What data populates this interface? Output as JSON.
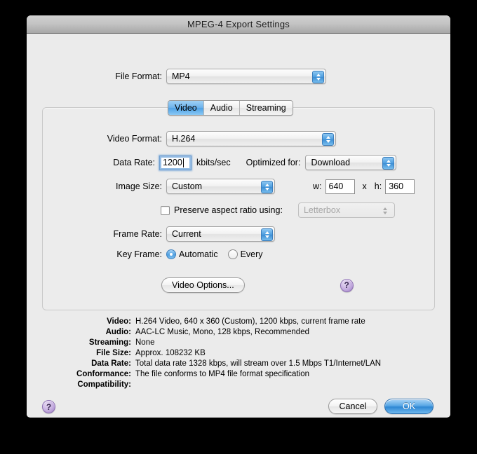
{
  "window": {
    "title": "MPEG-4 Export Settings"
  },
  "file_format": {
    "label": "File Format:",
    "value": "MP4"
  },
  "tabs": [
    {
      "label": "Video",
      "active": true
    },
    {
      "label": "Audio",
      "active": false
    },
    {
      "label": "Streaming",
      "active": false
    }
  ],
  "video": {
    "format": {
      "label": "Video Format:",
      "value": "H.264"
    },
    "data_rate": {
      "label": "Data Rate:",
      "value": "1200",
      "unit": "kbits/sec"
    },
    "optimized_for": {
      "label": "Optimized for:",
      "value": "Download"
    },
    "image_size": {
      "label": "Image Size:",
      "value": "Custom"
    },
    "width": {
      "label": "w:",
      "value": "640"
    },
    "dimension_separator": "x",
    "height": {
      "label": "h:",
      "value": "360"
    },
    "preserve_aspect": {
      "label": "Preserve aspect ratio using:",
      "checked": false,
      "mode": "Letterbox"
    },
    "frame_rate": {
      "label": "Frame Rate:",
      "value": "Current"
    },
    "key_frame": {
      "label": "Key Frame:",
      "automatic_label": "Automatic",
      "every_label": "Every",
      "selected": "Automatic"
    },
    "video_options_button": "Video Options...",
    "panel_help_icon": "?"
  },
  "summary": [
    {
      "key": "Video:",
      "value": "H.264 Video, 640 x 360 (Custom), 1200 kbps, current frame rate"
    },
    {
      "key": "Audio:",
      "value": "AAC-LC Music, Mono, 128 kbps, Recommended"
    },
    {
      "key": "Streaming:",
      "value": "None"
    },
    {
      "key": "File Size:",
      "value": "Approx. 108232 KB"
    },
    {
      "key": "Data Rate:",
      "value": "Total data rate 1328 kbps, will stream over 1.5 Mbps T1/Internet/LAN"
    },
    {
      "key": "Conformance:",
      "value": "The file conforms to MP4 file format specification"
    },
    {
      "key": "Compatibility:",
      "value": ""
    }
  ],
  "footer": {
    "help_icon": "?",
    "cancel_label": "Cancel",
    "ok_label": "OK"
  },
  "colors": {
    "accent_blue": "#4e9fe0",
    "help_purple": "#9d7ec4",
    "window_bg": "#ebebeb",
    "titlebar_top": "#d2d2d2",
    "titlebar_bottom": "#a8a8a8"
  }
}
